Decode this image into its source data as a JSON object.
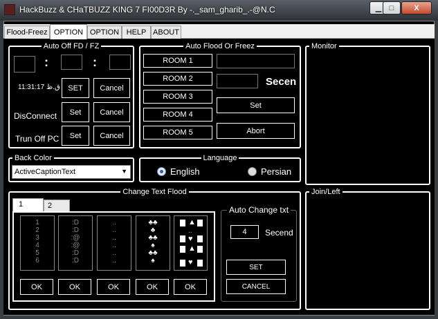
{
  "window": {
    "title": "HackBuzz & CHaTBUZZ KING 7 FI00D3R By -._sam_gharib_.-@N.C",
    "minimize_glyph": "▁",
    "maximize_glyph": "□",
    "close_glyph": "X"
  },
  "tabs": [
    "Flood-Freez",
    "OPTION",
    "OPTION",
    "HELP",
    "ABOUT"
  ],
  "auto_off": {
    "legend": "Auto Off FD / FZ",
    "colon": ":",
    "clock": "11:31:17 ",
    "clock_cut": "ق.ظ",
    "set_label": "SET",
    "cancel_label": "Cancel",
    "disconnect_label": "DisConnect",
    "disconnect_set": "Set",
    "disconnect_cancel": "Cancel",
    "turnoff_label": "Trun Off PC",
    "turnoff_set": "Set",
    "turnoff_cancel": "Cancel"
  },
  "auto_flood": {
    "legend": "Auto Flood Or Freez",
    "rooms": [
      "ROOM 1",
      "ROOM 2",
      "ROOM 3",
      "ROOM 4",
      "ROOM 5"
    ],
    "secend_label": "Secen",
    "set_label": "Set",
    "abort_label": "Abort"
  },
  "monitor": {
    "legend": "Monitor"
  },
  "back_color": {
    "legend": "Back Color",
    "selected": "ActiveCaptionText"
  },
  "language": {
    "legend": "Language",
    "english": "English",
    "persian": "Persian",
    "selected": "English"
  },
  "change_text": {
    "legend": "Change Text Flood",
    "subtabs": [
      "1",
      "2"
    ],
    "lists": [
      [
        "1",
        "2",
        "3",
        "4",
        "5",
        "6"
      ],
      [
        ":D",
        ":D",
        ":@",
        ":@",
        ":D",
        ":D"
      ],
      [
        "..",
        "..",
        "..",
        "..",
        "..",
        ".."
      ],
      [
        "♣♣",
        "♣",
        "♣♣",
        "♠",
        "♣♣",
        "♠"
      ]
    ],
    "ok_label": "OK",
    "auto_change": {
      "legend": "Auto Change txt",
      "value": "4",
      "secend_label": "Secend",
      "set_label": "SET",
      "cancel_label": "CANCEL"
    }
  },
  "join_left": {
    "legend": "Join/Left"
  }
}
